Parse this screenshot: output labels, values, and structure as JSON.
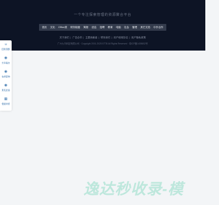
{
  "footer": {
    "slogan": "一个专注探索管理的资源聚合平台",
    "categories": [
      "首页",
      "文化",
      "Office类",
      "财务制度",
      "简报",
      "总结",
      "招聘",
      "教育",
      "电脑",
      "社会",
      "管理",
      "其它文档",
      "中外合作"
    ],
    "links": [
      "关于我们",
      "广告合作",
      "主要贡献者",
      "联系我们",
      "用户使用协议",
      "用户隐私政策"
    ],
    "copyright": "广州九鸟科技有限公司 · Copyright 2001-2025 57TB All Rights Reserved · 粤ICP备1405652号"
  },
  "sidebar": {
    "items": [
      {
        "label": "回到顶部",
        "icon": "user-icon"
      },
      {
        "label": "分享提交",
        "icon": "shield-icon"
      },
      {
        "label": "在线咨询",
        "icon": "chat-icon"
      },
      {
        "label": "意见反馈",
        "icon": "info-icon"
      },
      {
        "label": "便捷浏览",
        "icon": "grid-icon"
      }
    ]
  },
  "watermark": {
    "text": "逸达秒收录-模"
  },
  "colors": {
    "footer_bg": "#0d1425",
    "catbar_bg": "#333b4c",
    "accent": "#2d6ba8",
    "watermark": "#bde7dc"
  }
}
